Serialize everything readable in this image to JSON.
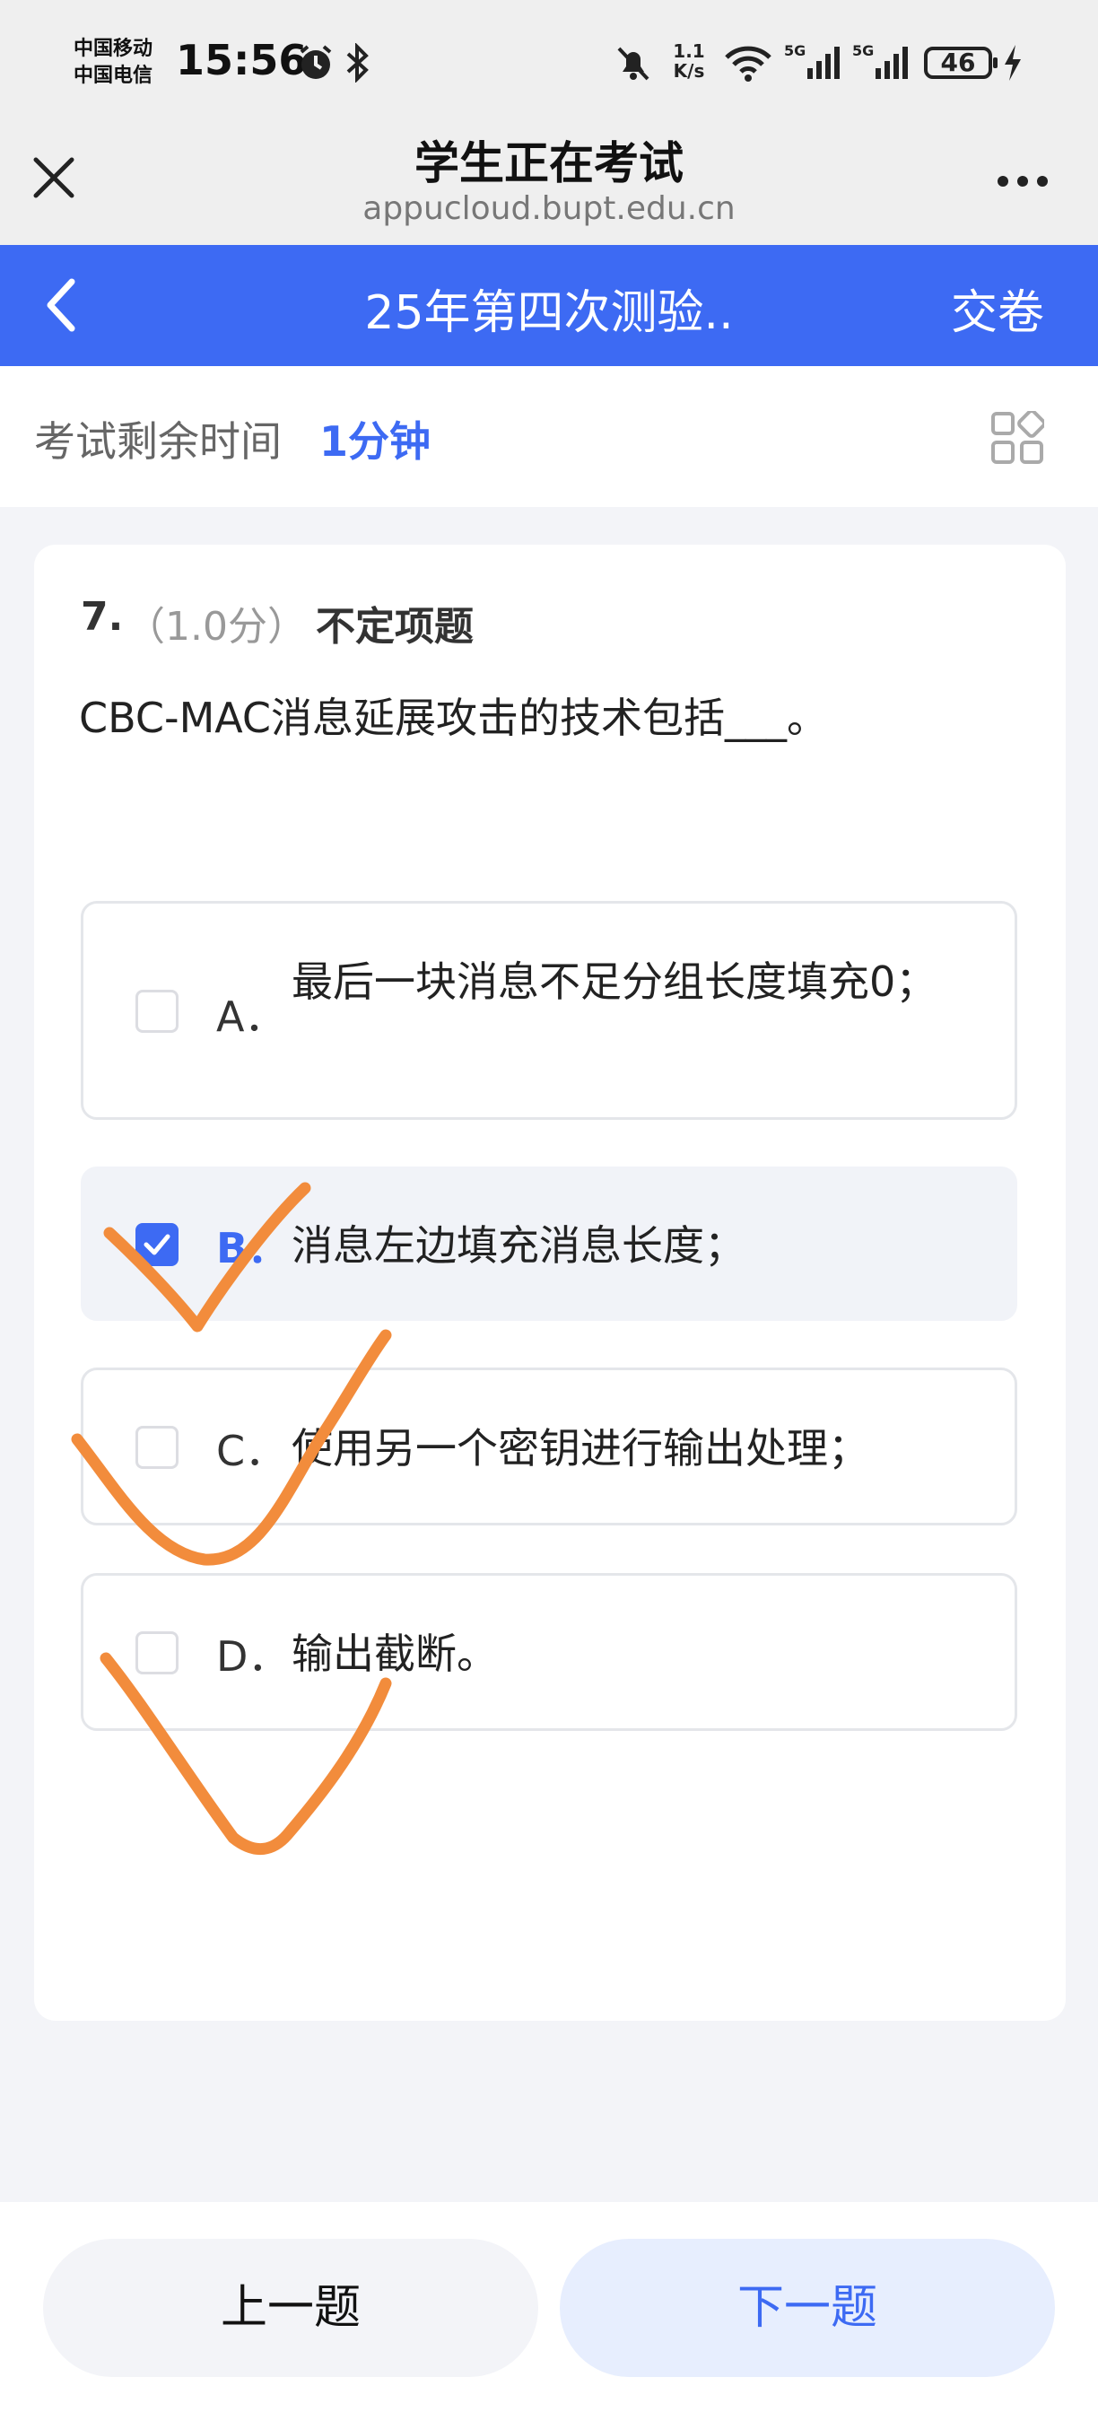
{
  "status_bar": {
    "carrier_1": "中国移动",
    "carrier_2": "中国电信",
    "time": "15:56",
    "net_speed_value": "1.1",
    "net_speed_unit": "K/s",
    "battery": "46",
    "icons": [
      "alarm-icon",
      "bluetooth-icon",
      "mute-bell-icon",
      "wifi-icon",
      "signal-5g-icon",
      "signal-5g-icon",
      "battery-icon",
      "charging-icon"
    ]
  },
  "browser": {
    "title": "学生正在考试",
    "url": "appucloud.bupt.edu.cn"
  },
  "exam_header": {
    "title": "25年第四次测验..",
    "submit_label": "交卷"
  },
  "timer": {
    "label": "考试剩余时间",
    "value": "1分钟"
  },
  "question": {
    "number": "7.",
    "score": "（1.0分）",
    "type": "不定项题",
    "text": "CBC-MAC消息延展攻击的技术包括___。",
    "options": [
      {
        "letter": "A．",
        "text": "最后一块消息不足分组长度填充0；",
        "checked": false
      },
      {
        "letter": "B．",
        "text": "消息左边填充消息长度；",
        "checked": true
      },
      {
        "letter": "C．",
        "text": "使用另一个密钥进行输出处理；",
        "checked": false
      },
      {
        "letter": "D．",
        "text": "输出截断。",
        "checked": false
      }
    ]
  },
  "navigation": {
    "prev_label": "上一题",
    "next_label": "下一题"
  },
  "colors": {
    "accent": "#3d6af3",
    "annotation": "#f28c3c"
  }
}
